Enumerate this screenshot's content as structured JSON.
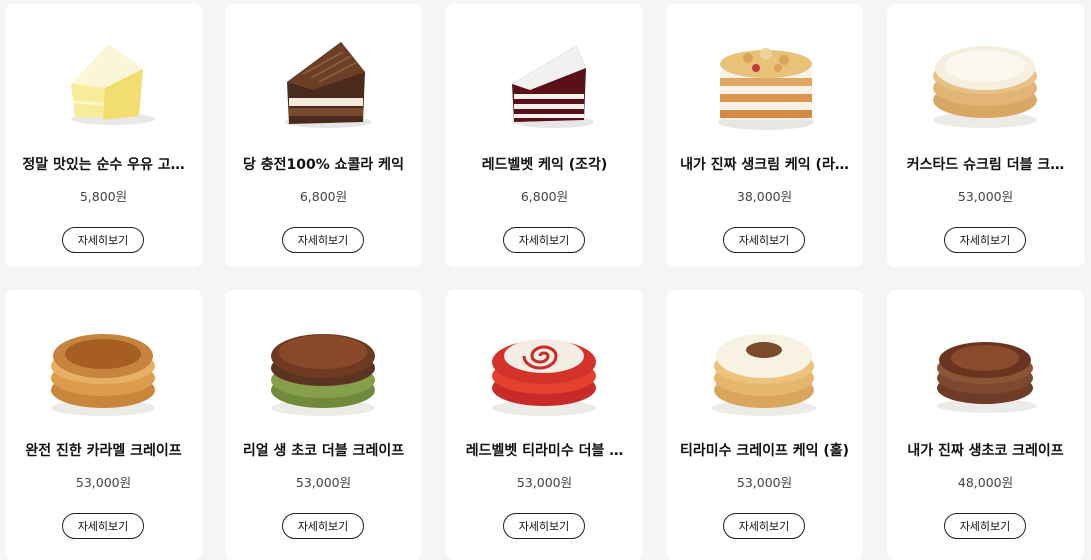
{
  "products": [
    {
      "name": "정말 맛있는 순수 우유 고…",
      "price": "5,800원",
      "button_label": "자세히보기",
      "image": "cheesecake-slice-image"
    },
    {
      "name": "당 충전100% 쇼콜라 케익",
      "price": "6,800원",
      "button_label": "자세히보기",
      "image": "chocolate-cake-slice-image"
    },
    {
      "name": "레드벨벳 케익 (조각)",
      "price": "6,800원",
      "button_label": "자세히보기",
      "image": "red-velvet-slice-image"
    },
    {
      "name": "내가 진짜 생크림 케익 (라…",
      "price": "38,000원",
      "button_label": "자세히보기",
      "image": "cream-crumble-cake-image"
    },
    {
      "name": "커스타드 슈크림 더블 크…",
      "price": "53,000원",
      "button_label": "자세히보기",
      "image": "custard-crepe-cake-image"
    },
    {
      "name": "완전 진한 카라멜 크레이프",
      "price": "53,000원",
      "button_label": "자세히보기",
      "image": "caramel-crepe-cake-image"
    },
    {
      "name": "리얼 생 초코 더블 크레이프",
      "price": "53,000원",
      "button_label": "자세히보기",
      "image": "choco-double-crepe-image"
    },
    {
      "name": "레드벨벳 티라미수 더블 …",
      "price": "53,000원",
      "button_label": "자세히보기",
      "image": "red-velvet-tiramisu-crepe-image"
    },
    {
      "name": "티라미수 크레이프 케익 (홀)",
      "price": "53,000원",
      "button_label": "자세히보기",
      "image": "tiramisu-crepe-cake-image"
    },
    {
      "name": "내가 진짜 생초코 크레이프",
      "price": "48,000원",
      "button_label": "자세히보기",
      "image": "choco-crepe-cake-image"
    }
  ]
}
